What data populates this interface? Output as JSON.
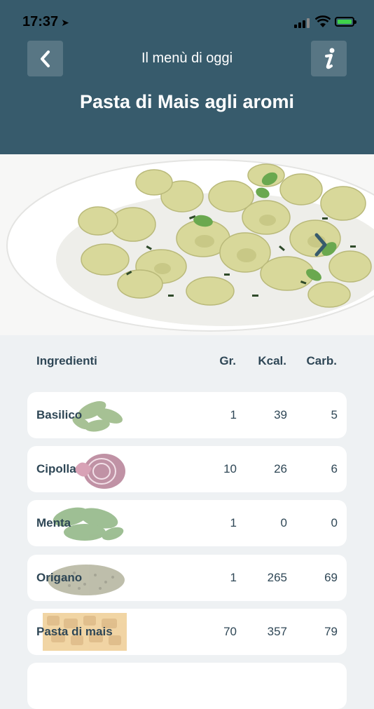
{
  "status_bar": {
    "time": "17:37"
  },
  "header": {
    "nav_title": "Il menù di oggi",
    "dish_title": "Pasta di Mais agli aromi"
  },
  "table": {
    "headers": {
      "name": "Ingredienti",
      "gr": "Gr.",
      "kcal": "Kcal.",
      "carb": "Carb."
    },
    "rows": [
      {
        "name": "Basilico",
        "gr": "1",
        "kcal": "39",
        "carb": "5",
        "thumb": "basil"
      },
      {
        "name": "Cipolla",
        "gr": "10",
        "kcal": "26",
        "carb": "6",
        "thumb": "onion"
      },
      {
        "name": "Menta",
        "gr": "1",
        "kcal": "0",
        "carb": "0",
        "thumb": "mint"
      },
      {
        "name": "Origano",
        "gr": "1",
        "kcal": "265",
        "carb": "69",
        "thumb": "oregano"
      },
      {
        "name": "Pasta di mais",
        "gr": "70",
        "kcal": "357",
        "carb": "79",
        "thumb": "pasta"
      }
    ]
  },
  "icons": {
    "back": "chevron-left-icon",
    "info": "info-icon",
    "next_photo": "chevron-right-icon"
  },
  "colors": {
    "header_bg": "#375b6c",
    "page_bg": "#eef1f3",
    "text_dark": "#2f4756"
  }
}
